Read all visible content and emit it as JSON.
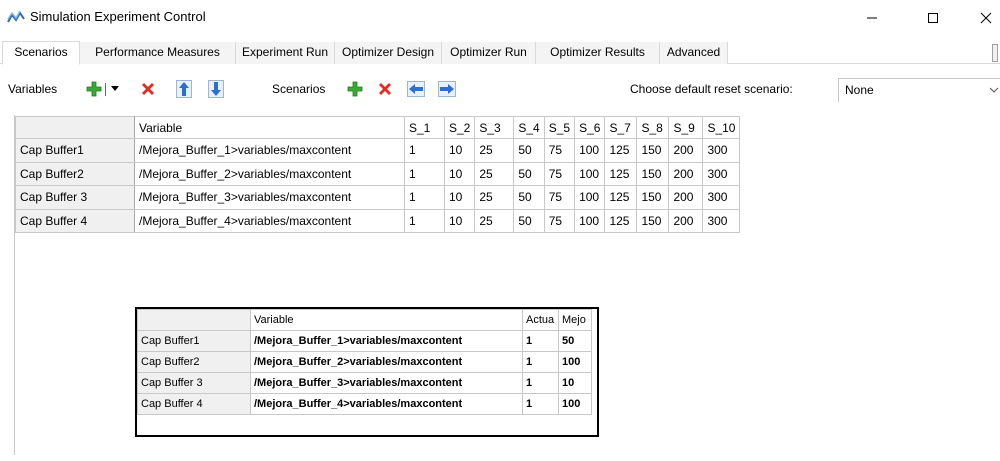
{
  "window": {
    "title": "Simulation Experiment Control",
    "app_icon": "wave-icon",
    "controls": [
      "minimize-icon",
      "maximize-icon",
      "close-icon"
    ]
  },
  "tabs": [
    {
      "label": "Scenarios",
      "active": true
    },
    {
      "label": "Performance Measures",
      "active": false
    },
    {
      "label": "Experiment Run",
      "active": false
    },
    {
      "label": "Optimizer Design",
      "active": false
    },
    {
      "label": "Optimizer Run",
      "active": false
    },
    {
      "label": "Optimizer Results",
      "active": false
    },
    {
      "label": "Advanced",
      "active": false
    }
  ],
  "toolbar": {
    "variables_label": "Variables",
    "scenarios_label": "Scenarios",
    "default_reset_label": "Choose default reset scenario:",
    "default_reset_value": "None",
    "icons": {
      "add": "plus-icon",
      "dropdown": "dropdown-arrow-icon",
      "delete": "delete-x-icon",
      "up": "arrow-up-icon",
      "down": "arrow-down-icon",
      "left": "arrow-left-icon",
      "right": "arrow-right-icon"
    },
    "colors": {
      "add": "#2e9e2e",
      "delete": "#e02020",
      "arrow": "#2a6fd6"
    }
  },
  "grid": {
    "columns": [
      "Variable",
      "S_1",
      "S_2",
      "S_3",
      "S_4",
      "S_5",
      "S_6",
      "S_7",
      "S_8",
      "S_9",
      "S_10"
    ],
    "rows": [
      {
        "name": "Cap Buffer1",
        "variable": "/Mejora_Buffer_1>variables/maxcontent",
        "values": [
          "1",
          "10",
          "25",
          "50",
          "75",
          "100",
          "125",
          "150",
          "200",
          "300"
        ]
      },
      {
        "name": "Cap Buffer2",
        "variable": "/Mejora_Buffer_2>variables/maxcontent",
        "values": [
          "1",
          "10",
          "25",
          "50",
          "75",
          "100",
          "125",
          "150",
          "200",
          "300"
        ]
      },
      {
        "name": "Cap Buffer 3",
        "variable": "/Mejora_Buffer_3>variables/maxcontent",
        "values": [
          "1",
          "10",
          "25",
          "50",
          "75",
          "100",
          "125",
          "150",
          "200",
          "300"
        ]
      },
      {
        "name": "Cap Buffer 4",
        "variable": "/Mejora_Buffer_4>variables/maxcontent",
        "values": [
          "1",
          "10",
          "25",
          "50",
          "75",
          "100",
          "125",
          "150",
          "200",
          "300"
        ]
      }
    ]
  },
  "inset": {
    "columns": [
      "Variable",
      "Actua",
      "Mejo"
    ],
    "rows": [
      {
        "name": "Cap Buffer1",
        "variable": "/Mejora_Buffer_1>variables/maxcontent",
        "actual": "1",
        "mejora": "50"
      },
      {
        "name": "Cap Buffer2",
        "variable": "/Mejora_Buffer_2>variables/maxcontent",
        "actual": "1",
        "mejora": "100"
      },
      {
        "name": "Cap Buffer 3",
        "variable": "/Mejora_Buffer_3>variables/maxcontent",
        "actual": "1",
        "mejora": "10"
      },
      {
        "name": "Cap Buffer 4",
        "variable": "/Mejora_Buffer_4>variables/maxcontent",
        "actual": "1",
        "mejora": "100"
      }
    ]
  }
}
